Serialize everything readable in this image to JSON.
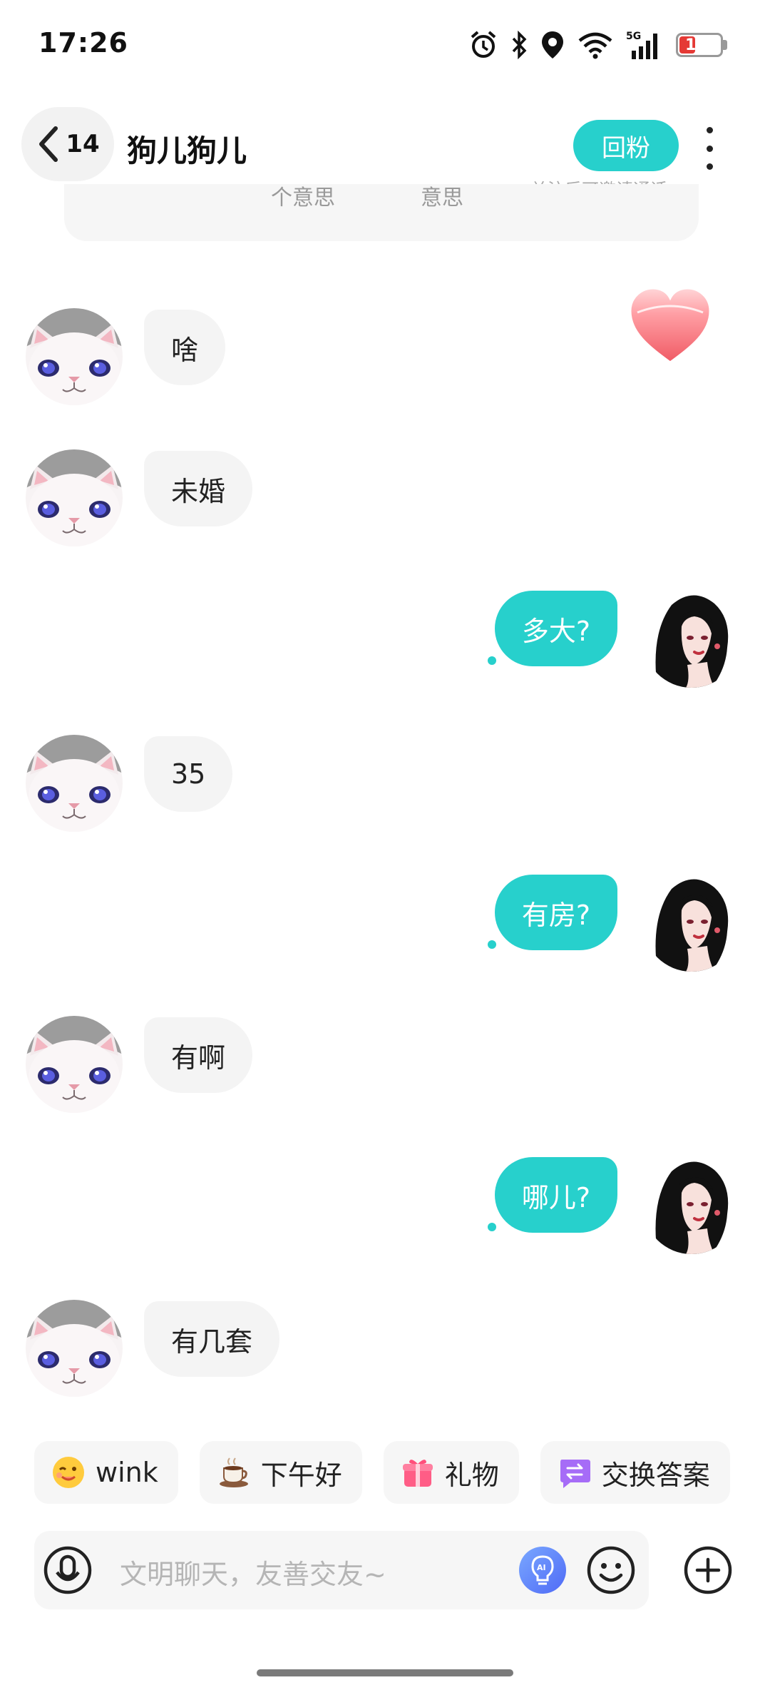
{
  "status_bar": {
    "time": "17:26",
    "battery": "18",
    "network": "5G"
  },
  "header": {
    "back_count": "14",
    "title": "狗儿狗儿",
    "follow_label": "回粉",
    "follow_hint": "关注后可邀请通话"
  },
  "top_card": {
    "fragments": [
      "个意思",
      "意思"
    ]
  },
  "messages": [
    {
      "side": "in",
      "text": "啥"
    },
    {
      "side": "in",
      "text": "未婚"
    },
    {
      "side": "out",
      "text": "多大?"
    },
    {
      "side": "in",
      "text": "35"
    },
    {
      "side": "out",
      "text": "有房?"
    },
    {
      "side": "in",
      "text": "有啊"
    },
    {
      "side": "out",
      "text": "哪儿?"
    },
    {
      "side": "in",
      "text": "有几套"
    }
  ],
  "quick_replies": [
    {
      "label": "wink",
      "icon": "wink-emoji-icon"
    },
    {
      "label": "下午好",
      "icon": "coffee-cup-icon"
    },
    {
      "label": "礼物",
      "icon": "gift-icon"
    },
    {
      "label": "交换答案",
      "icon": "exchange-icon"
    }
  ],
  "input": {
    "placeholder": "文明聊天，友善交友~"
  },
  "colors": {
    "accent": "#27d0cc",
    "bubble_in": "#f4f4f4",
    "heart": "#f06a72"
  }
}
